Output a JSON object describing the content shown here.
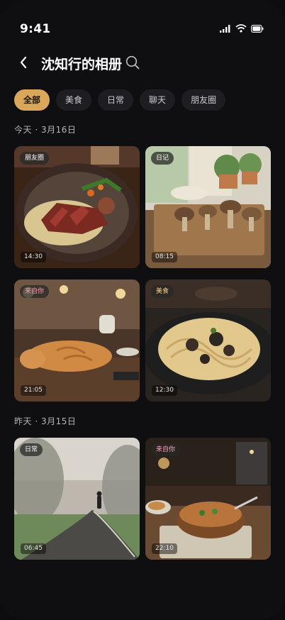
{
  "status": {
    "time": "9:41"
  },
  "header": {
    "title": "沈知行的相册"
  },
  "tabs": [
    {
      "label": "全部",
      "active": true
    },
    {
      "label": "美食",
      "active": false
    },
    {
      "label": "日常",
      "active": false
    },
    {
      "label": "聊天",
      "active": false
    },
    {
      "label": "朋友圈",
      "active": false
    }
  ],
  "sections": [
    {
      "label": "今天 · 3月16日"
    },
    {
      "label": "昨天 · 3月15日"
    }
  ],
  "photos": [
    {
      "tag": "朋友圈",
      "time": "14:30",
      "subject": "steak-plate"
    },
    {
      "tag": "日记",
      "time": "08:15",
      "subject": "mushrooms-board"
    },
    {
      "tag": "来自你",
      "time": "21:05",
      "subject": "sleeping-cat"
    },
    {
      "tag": "美食",
      "time": "12:30",
      "subject": "truffle-pasta"
    },
    {
      "tag": "日常",
      "time": "06:45",
      "subject": "foggy-path"
    },
    {
      "tag": "来自你",
      "time": "22:10",
      "subject": "soup-bowl"
    }
  ],
  "colors": {
    "accent": "#d8a75a",
    "background": "#0f0f12",
    "chip": "#1e1e22"
  }
}
